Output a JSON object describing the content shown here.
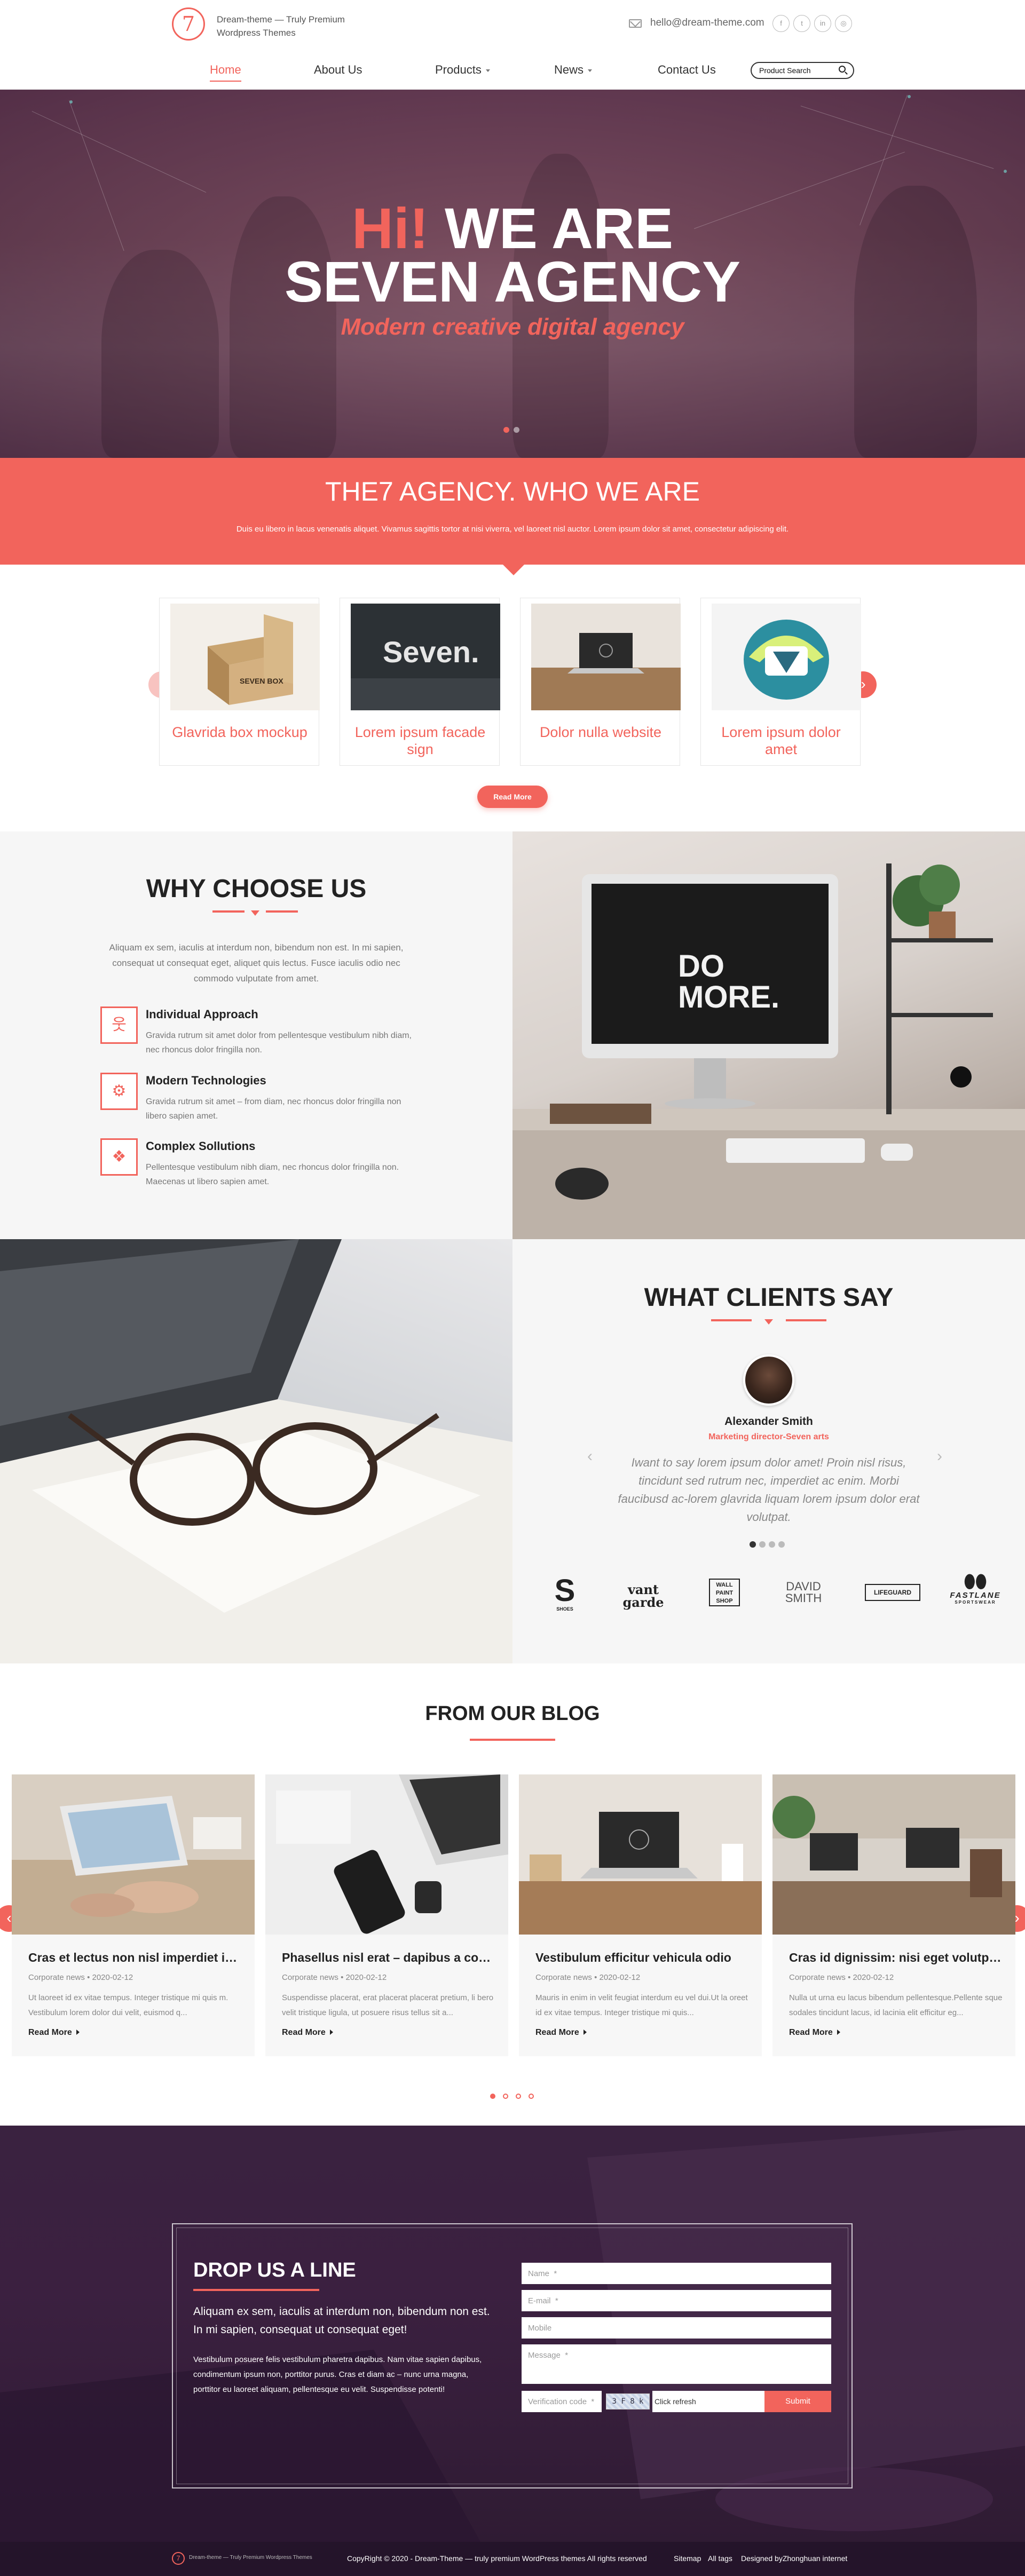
{
  "header": {
    "logo_glyph": "7",
    "logo_line1": "Dream-theme — Truly Premium",
    "logo_line2": "Wordpress Themes",
    "email": "hello@dream-theme.com",
    "social_icons": [
      "facebook-icon",
      "twitter-icon",
      "linkedin-icon",
      "instagram-icon"
    ],
    "nav": [
      {
        "label": "Home",
        "active": true
      },
      {
        "label": "About Us"
      },
      {
        "label": "Products",
        "has_dropdown": true
      },
      {
        "label": "News",
        "has_dropdown": true
      },
      {
        "label": "Contact Us"
      }
    ],
    "search_placeholder": "Product Search"
  },
  "hero": {
    "hi": "Hi!",
    "title_line1": "WE ARE",
    "title_line2": "SEVEN AGENCY",
    "subtitle": "Modern creative digital agency",
    "dots": 2,
    "active_dot": 0
  },
  "who": {
    "title": "THE7 AGENCY. WHO WE ARE",
    "text": "Duis eu libero in lacus venenatis aliquet. Vivamus sagittis tortor at nisi viverra, vel laoreet nisl auctor. Lorem ipsum dolor sit amet, consectetur adipiscing elit."
  },
  "products": {
    "items": [
      {
        "title": "Glavrida box mockup"
      },
      {
        "title": "Lorem ipsum facade sign"
      },
      {
        "title": "Dolor nulla website"
      },
      {
        "title": "Lorem ipsum dolor amet"
      }
    ],
    "box_text": "SEVEN BOX",
    "sign_text": "Seven.",
    "prev": "‹",
    "next": "›",
    "more_button": "Read More"
  },
  "why": {
    "title": "WHY CHOOSE US",
    "intro": "Aliquam ex sem, iaculis at interdum non, bibendum non est. In mi sapien, consequat ut consequat eget, aliquet quis lectus. Fusce iaculis odio nec commodo vulputate from amet.",
    "features": [
      {
        "icon": "person-icon",
        "glyph": "웃",
        "title": "Individual Approach",
        "desc": "Gravida rutrum sit amet dolor from pellentesque vestibulum nibh diam, nec rhoncus dolor fringilla non."
      },
      {
        "icon": "gears-icon",
        "glyph": "⚙",
        "title": "Modern Technologies",
        "desc": "Gravida rutrum sit amet – from diam, nec rhoncus dolor fringilla non libero sapien amet."
      },
      {
        "icon": "cubes-icon",
        "glyph": "❖",
        "title": "Complex Sollutions",
        "desc": "Pellentesque vestibulum nibh diam, nec rhoncus dolor fringilla non. Maecenas ut libero sapien amet."
      }
    ],
    "screen_text_1": "DO",
    "screen_text_2": "MORE."
  },
  "clients": {
    "title": "WHAT CLIENTS SAY",
    "name": "Alexander Smith",
    "role": "Marketing director-Seven arts",
    "quote": "Iwant to say lorem ipsum dolor amet! Proin nisl risus, tincidunt sed rutrum nec, imperdiet ac enim. Morbi faucibusd ac-lorem glavrida liquam lorem ipsum dolor erat volutpat.",
    "prev": "‹",
    "next": "›",
    "dots": 4,
    "active_dot": 0,
    "brands": [
      "S",
      "vant garde",
      "WALL PAINT SHOP",
      "DAVID SMITH",
      "LIFEGUARD",
      "FASTLANE"
    ],
    "brand_sub": [
      "SHOES",
      "",
      "",
      "",
      "",
      "SPORTSWEAR"
    ]
  },
  "blog": {
    "title": "FROM OUR BLOG",
    "posts": [
      {
        "title": "Cras et lectus non nisl imperdiet in ...",
        "category": "Corporate news",
        "date": "2020-02-12",
        "excerpt": "Ut laoreet id ex vitae tempus. Integer tristique mi quis m. Vestibulum lorem dolor dui velit, euismod q...",
        "more": "Read More"
      },
      {
        "title": "Phasellus nisl erat – dapibus a conv...",
        "category": "Corporate news",
        "date": "2020-02-12",
        "excerpt": "Suspendisse placerat, erat placerat placerat pretium, li bero velit tristique ligula, ut posuere risus tellus sit a...",
        "more": "Read More"
      },
      {
        "title": "Vestibulum efficitur vehicula odio",
        "category": "Corporate news",
        "date": "2020-02-12",
        "excerpt": "Mauris in enim in velit feugiat interdum eu vel dui.Ut la oreet id ex vitae tempus. Integer tristique mi quis...",
        "more": "Read More"
      },
      {
        "title": "Cras id dignissim: nisi eget volutpat...",
        "category": "Corporate news",
        "date": "2020-02-12",
        "excerpt": "Nulla ut urna eu lacus bibendum pellentesque.Pellente sque sodales tincidunt lacus, id lacinia elit efficitur eg...",
        "more": "Read More"
      }
    ],
    "meta_sep": "•",
    "prev": "‹",
    "next": "›",
    "dots": 4,
    "active_dot": 0
  },
  "contact": {
    "title": "DROP US A LINE",
    "lead": "Aliquam ex sem, iaculis at interdum non, bibendum non est. In mi sapien, consequat ut consequat eget!",
    "body": "Vestibulum posuere felis vestibulum pharetra dapibus. Nam vitae sapien dapibus, condimentum ipsum non, porttitor purus. Cras et diam ac – nunc urna magna, porttitor eu laoreet aliquam, pellentesque eu velit. Suspendisse potenti!",
    "fields": {
      "name": "Name  *",
      "email": "E-mail  *",
      "mobile": "Mobile",
      "message": "Message  *",
      "verification": "Verification code  *"
    },
    "captcha_text": "3 F 8 k",
    "click_refresh": "Click refresh",
    "submit": "Submit"
  },
  "footer": {
    "logo_text": "Dream-theme — Truly Premium Wordpress Themes",
    "copyright": "CopyRight © 2020 - Dream-Theme — truly premium WordPress themes  All rights reserved",
    "sitemap": "Sitemap",
    "all_tags": "All tags",
    "designed": "Designed byZhonghuan internet"
  },
  "colors": {
    "accent": "#f2645c",
    "dark": "#222222",
    "contact_bg": "#3a2240",
    "footer_bg": "#24142a"
  }
}
